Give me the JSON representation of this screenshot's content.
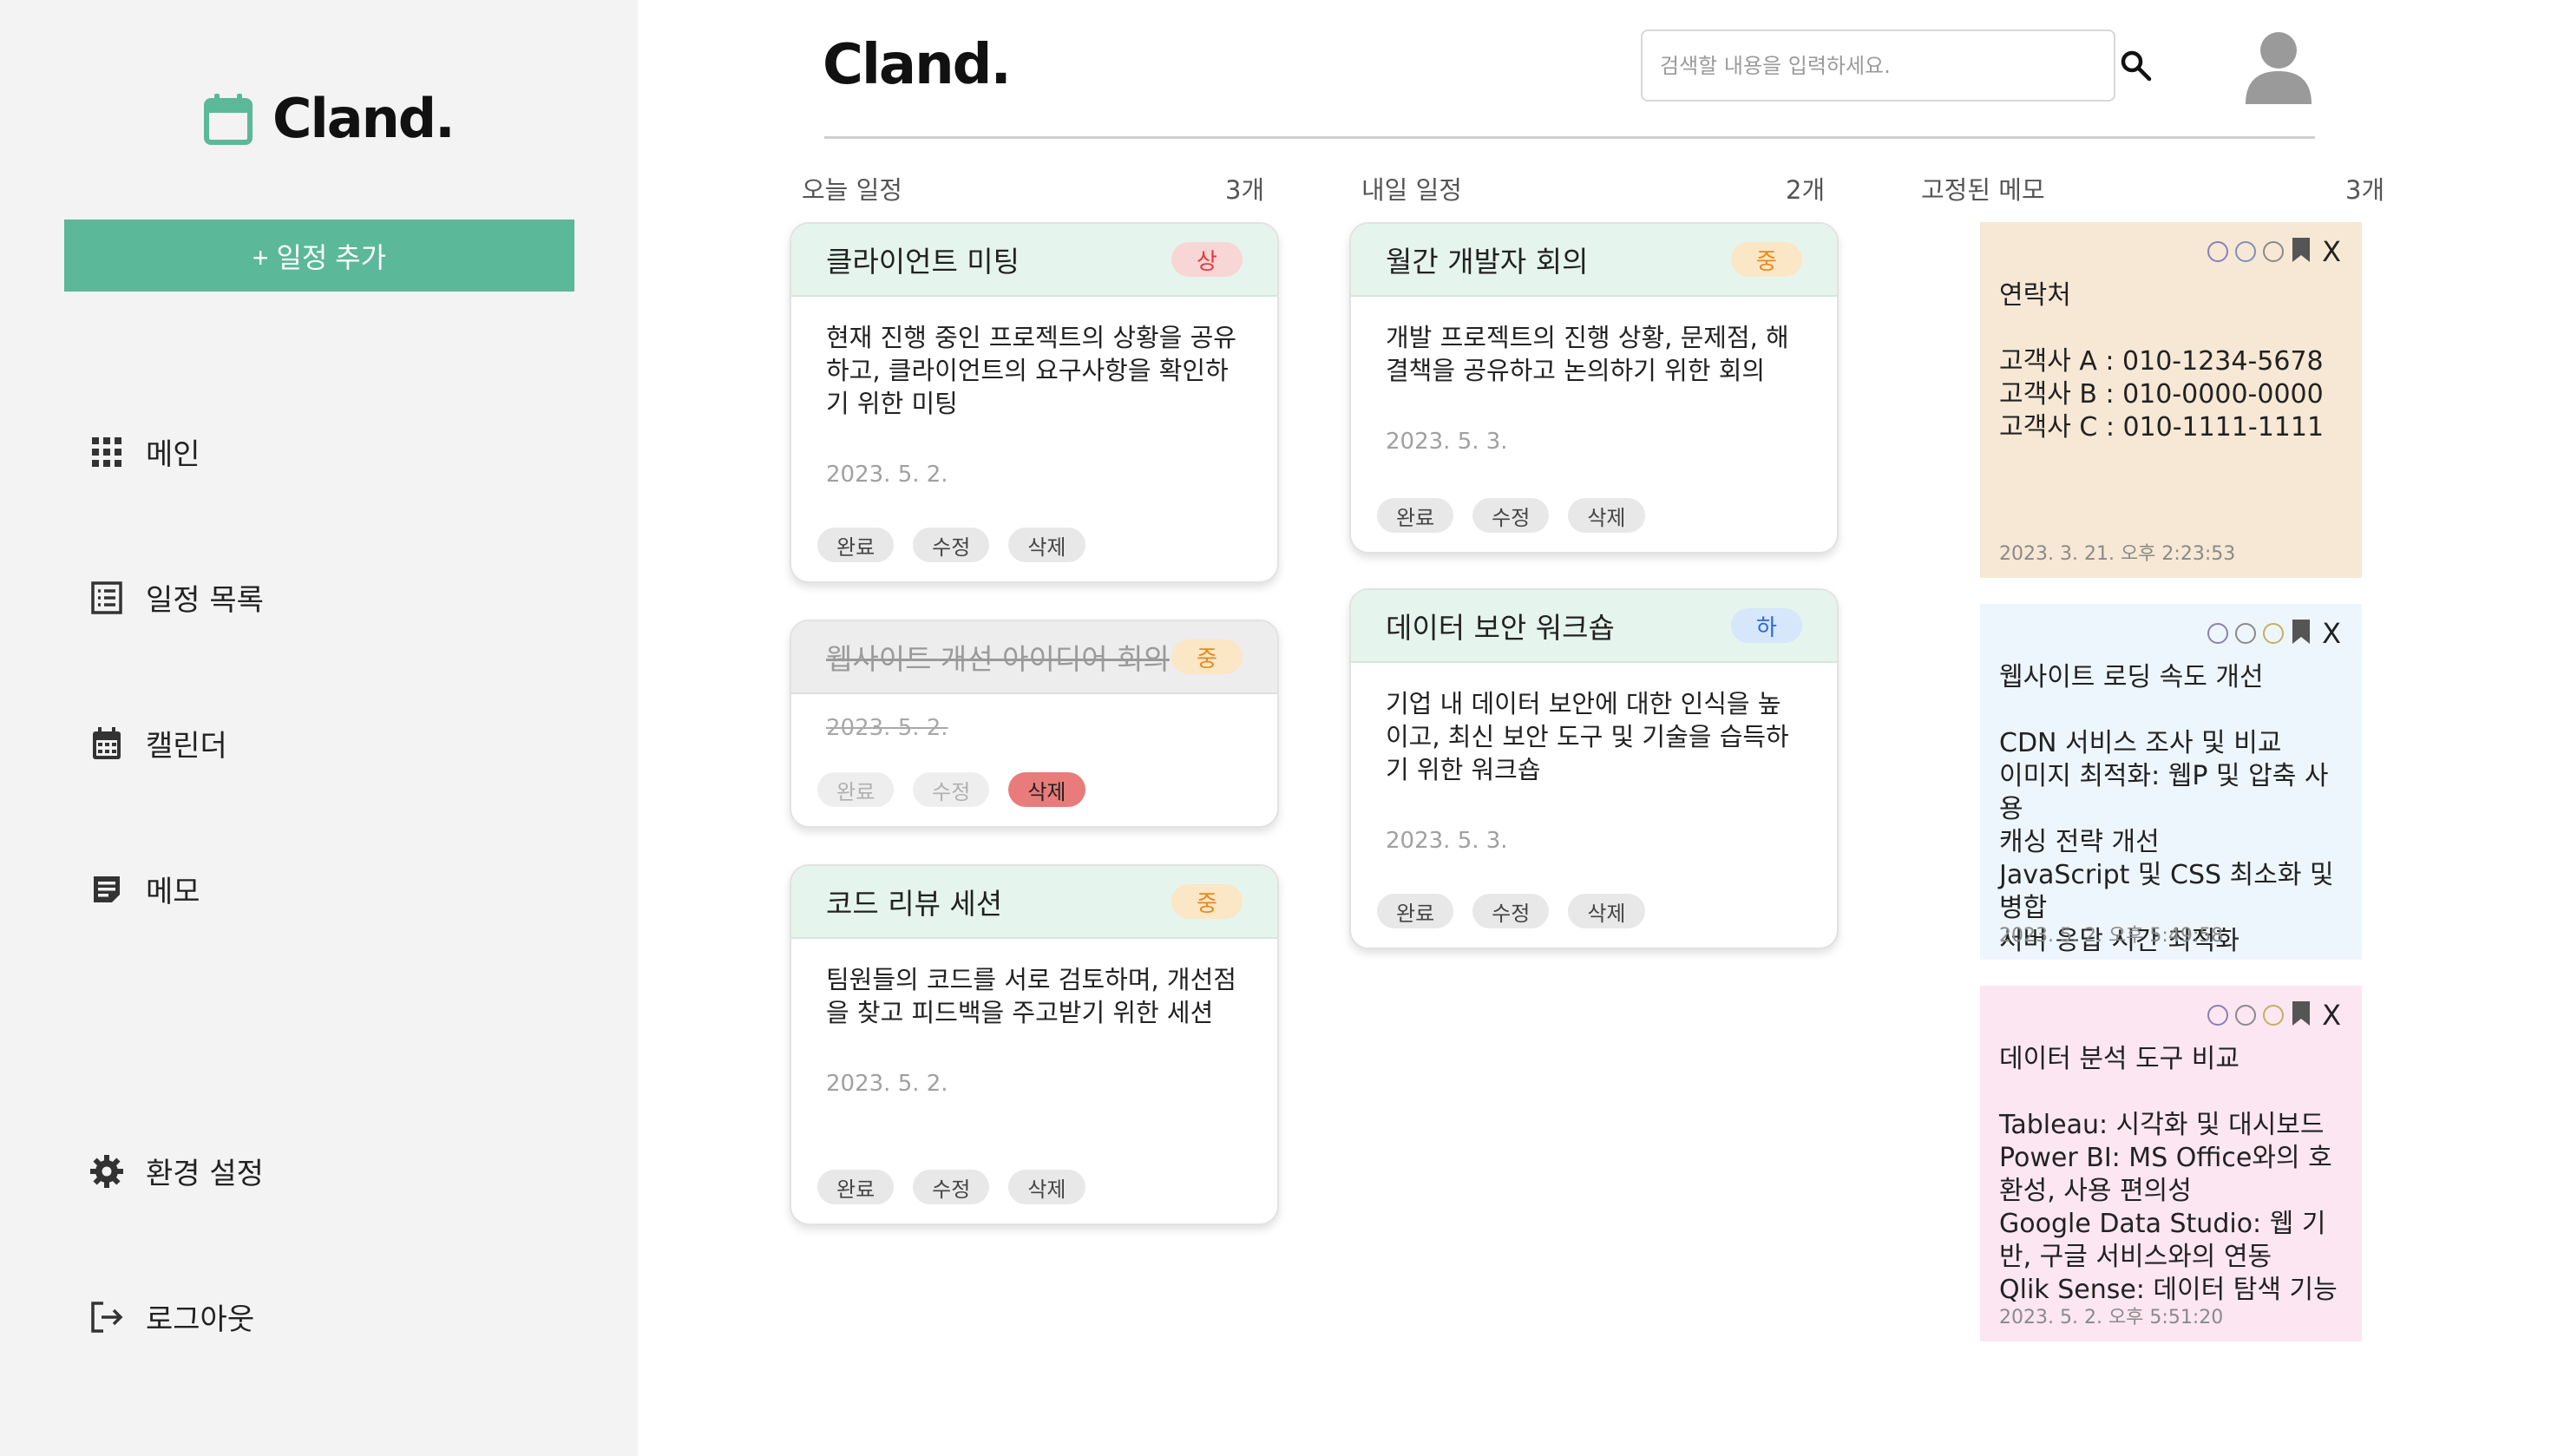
{
  "app": {
    "logo_text": "Cland.",
    "header_title": "Cland."
  },
  "sidebar": {
    "add_button": "+ 일정 추가",
    "items": [
      {
        "label": "메인",
        "icon": "grid-icon"
      },
      {
        "label": "일정 목록",
        "icon": "list-icon"
      },
      {
        "label": "캘린더",
        "icon": "calendar-icon"
      },
      {
        "label": "메모",
        "icon": "note-icon"
      }
    ],
    "settings_label": "환경 설정",
    "logout_label": "로그아웃"
  },
  "search": {
    "placeholder": "검색할 내용을 입력하세요.",
    "value": ""
  },
  "columns": {
    "today": {
      "label": "오늘 일정",
      "count": "3개"
    },
    "tomorrow": {
      "label": "내일 일정",
      "count": "2개"
    },
    "pinned": {
      "label": "고정된 메모",
      "count": "3개"
    }
  },
  "actions": {
    "complete": "완료",
    "edit": "수정",
    "delete": "삭제"
  },
  "today_cards": [
    {
      "title": "클라이언트 미팅",
      "priority": "상",
      "description": "현재 진행 중인 프로젝트의 상황을 공유하고, 클라이언트의 요구사항을 확인하기 위한 미팅",
      "date": "2023. 5. 2."
    },
    {
      "title": "웹사이트 개선 아이디어 회의",
      "priority": "중",
      "description": "",
      "date": "2023. 5. 2."
    },
    {
      "title": "코드 리뷰 세션",
      "priority": "중",
      "description": "팀원들의 코드를 서로 검토하며, 개선점을 찾고 피드백을 주고받기 위한 세션",
      "date": "2023. 5. 2."
    }
  ],
  "tomorrow_cards": [
    {
      "title": "월간 개발자 회의",
      "priority": "중",
      "description": "개발 프로젝트의 진행 상황, 문제점, 해결책을 공유하고 논의하기 위한 회의",
      "date": "2023. 5. 3."
    },
    {
      "title": "데이터 보안 워크숍",
      "priority": "하",
      "description": "기업 내 데이터 보안에 대한 인식을 높이고, 최신 보안 도구 및 기술을 습득하기 위한 워크숍",
      "date": "2023. 5. 3."
    }
  ],
  "memos": [
    {
      "title": "연락처",
      "body": "고객사 A : 010-1234-5678\n고객사 B : 010-0000-0000\n고객사 C : 010-1111-1111",
      "time": "2023. 3. 21. 오후 2:23:53",
      "color": "#f6e8d4",
      "close": "X"
    },
    {
      "title": "웹사이트 로딩 속도 개선",
      "body": "CDN 서비스 조사 및 비교\n이미지 최적화: 웹P 및 압축 사용\n캐싱 전략 개선\nJavaScript 및 CSS 최소화 및 병합\n서버 응답 시간 최적화",
      "time": "2023. 5. 2. 오후 5:49:58",
      "color": "#eef6fd",
      "close": "X"
    },
    {
      "title": "데이터 분석 도구 비교",
      "body": "Tableau: 시각화 및 대시보드\nPower BI: MS Office와의 호환성, 사용 편의성\nGoogle Data Studio: 웹 기반, 구글 서비스와의 연동\nQlik Sense: 데이터 탐색 기능",
      "time": "2023. 5. 2. 오후 5:51:20",
      "color": "#fbe6f1",
      "close": "X"
    }
  ],
  "colors": {
    "accent": "#5bb898",
    "card_header": "#e6f4ee",
    "sidebar_bg": "#f3f3f3"
  }
}
